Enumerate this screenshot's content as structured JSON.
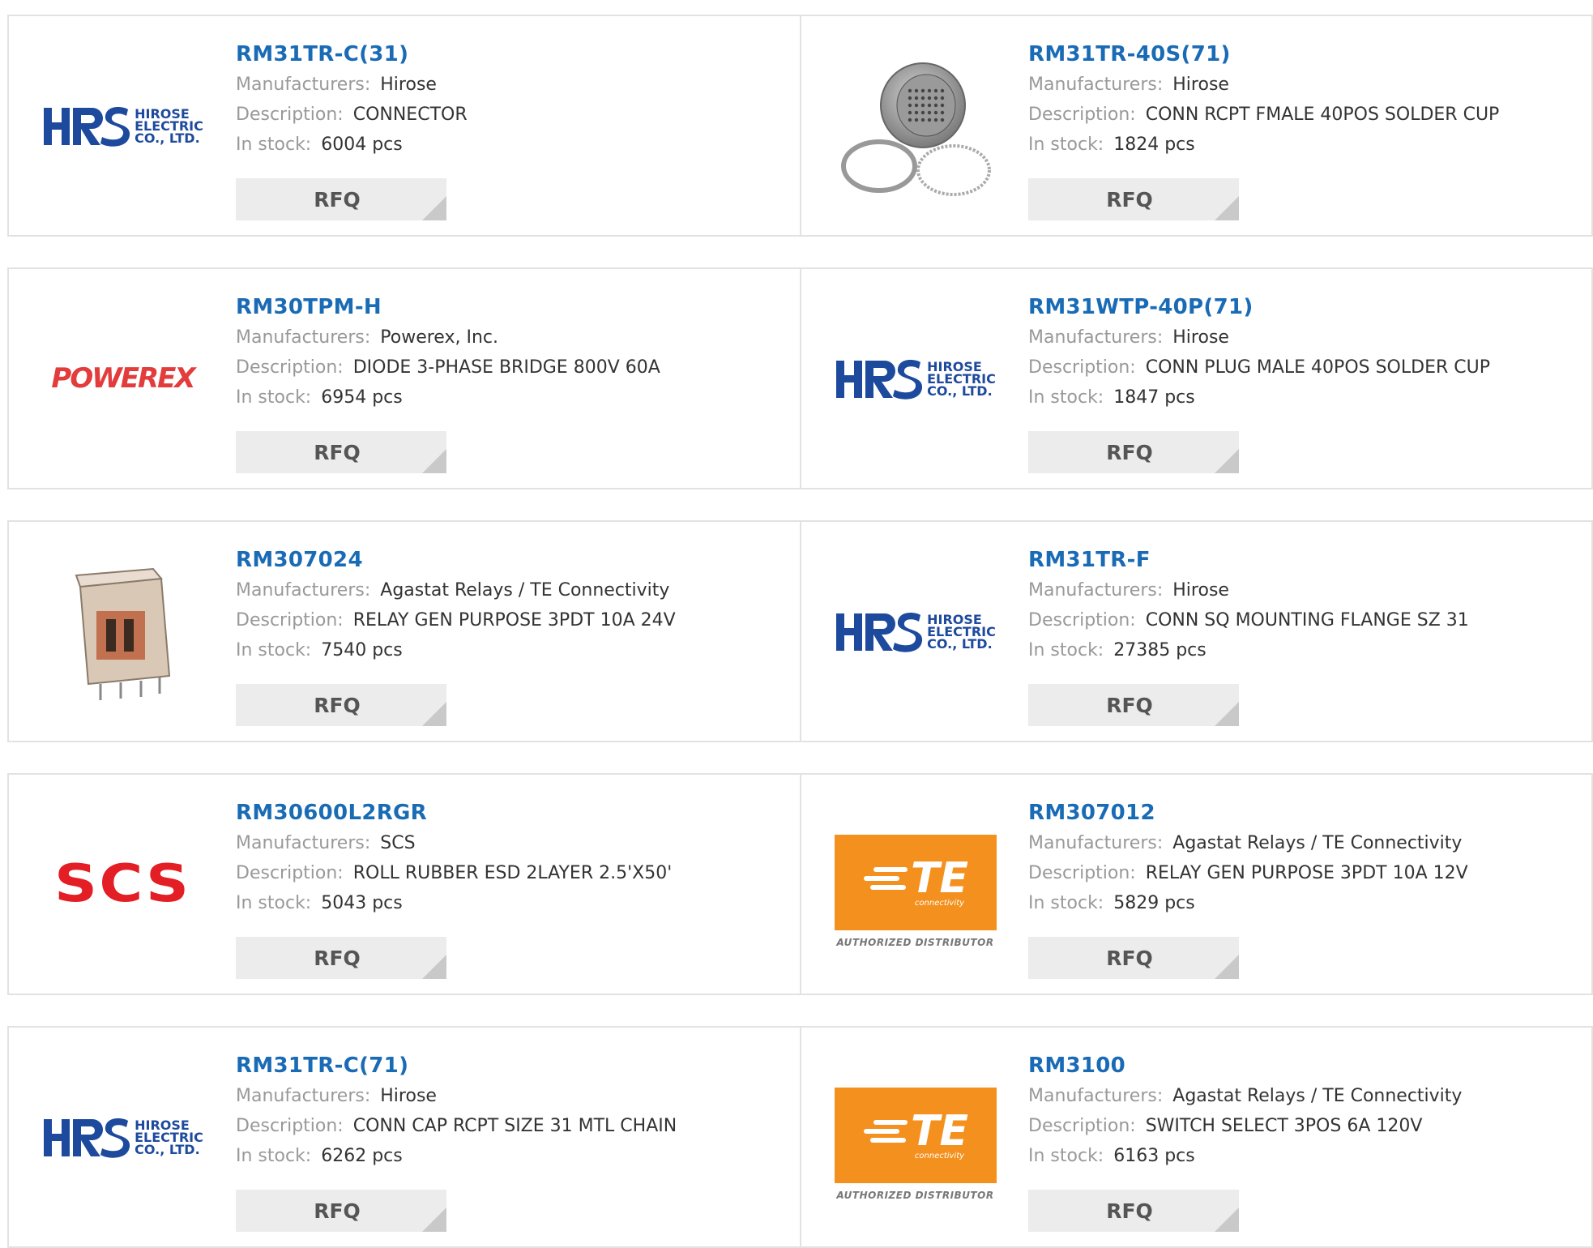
{
  "labels": {
    "manufacturers": "Manufacturers:",
    "description": "Description:",
    "in_stock": "In stock:",
    "rfq": "RFQ"
  },
  "logos": {
    "hrs_line1": "HIROSE",
    "hrs_line2": "ELECTRIC",
    "hrs_line3": "CO., LTD.",
    "hrs_mark": "HRS",
    "powerex": "POWEREX",
    "scs": "SCS",
    "te_main": "TE",
    "te_sub": "connectivity",
    "te_auth": "AUTHORIZED DISTRIBUTOR"
  },
  "colors": {
    "part_link": "#1a6bb5",
    "label_gray": "#999999",
    "hrs_blue": "#1e4a9e",
    "powerex_red": "#e23c3c",
    "scs_red": "#e31e24",
    "te_orange": "#f4901e"
  },
  "products": [
    {
      "part": "RM31TR-C(31)",
      "manufacturer": "Hirose",
      "description": "CONNECTOR",
      "stock": "6004 pcs",
      "image": "hrs-logo"
    },
    {
      "part": "RM31TR-40S(71)",
      "manufacturer": "Hirose",
      "description": "CONN RCPT FMALE 40POS SOLDER CUP",
      "stock": "1824 pcs",
      "image": "circular-connector-photo"
    },
    {
      "part": "RM30TPM-H",
      "manufacturer": "Powerex, Inc.",
      "description": "DIODE 3-PHASE BRIDGE 800V 60A",
      "stock": "6954 pcs",
      "image": "powerex-logo"
    },
    {
      "part": "RM31WTP-40P(71)",
      "manufacturer": "Hirose",
      "description": "CONN PLUG MALE 40POS SOLDER CUP",
      "stock": "1847 pcs",
      "image": "hrs-logo"
    },
    {
      "part": "RM307024",
      "manufacturer": "Agastat Relays / TE Connectivity",
      "description": "RELAY GEN PURPOSE 3PDT 10A 24V",
      "stock": "7540 pcs",
      "image": "relay-photo"
    },
    {
      "part": "RM31TR-F",
      "manufacturer": "Hirose",
      "description": "CONN SQ MOUNTING FLANGE SZ 31",
      "stock": "27385 pcs",
      "image": "hrs-logo"
    },
    {
      "part": "RM30600L2RGR",
      "manufacturer": "SCS",
      "description": "ROLL RUBBER ESD 2LAYER 2.5'X50'",
      "stock": "5043 pcs",
      "image": "scs-logo"
    },
    {
      "part": "RM307012",
      "manufacturer": "Agastat Relays / TE Connectivity",
      "description": "RELAY GEN PURPOSE 3PDT 10A 12V",
      "stock": "5829 pcs",
      "image": "te-logo"
    },
    {
      "part": "RM31TR-C(71)",
      "manufacturer": "Hirose",
      "description": "CONN CAP RCPT SIZE 31 MTL CHAIN",
      "stock": "6262 pcs",
      "image": "hrs-logo"
    },
    {
      "part": "RM3100",
      "manufacturer": "Agastat Relays / TE Connectivity",
      "description": "SWITCH SELECT 3POS 6A 120V",
      "stock": "6163 pcs",
      "image": "te-logo"
    }
  ]
}
